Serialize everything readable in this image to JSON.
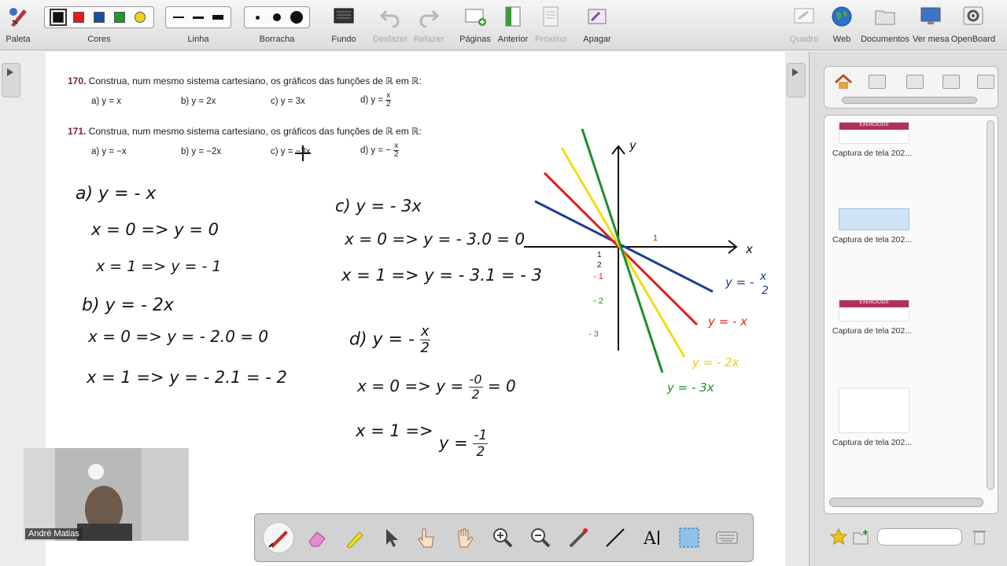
{
  "toolbar": {
    "items": [
      {
        "label": "Paleta"
      },
      {
        "label": "Cores"
      },
      {
        "label": "Linha"
      },
      {
        "label": "Borracha"
      },
      {
        "label": "Fundo"
      },
      {
        "label": "Desfazer"
      },
      {
        "label": "Refazer"
      },
      {
        "label": "Páginas"
      },
      {
        "label": "Anterior"
      },
      {
        "label": "Próximo"
      },
      {
        "label": "Apagar"
      },
      {
        "label": "Quadro"
      },
      {
        "label": "Web"
      },
      {
        "label": "Documentos"
      },
      {
        "label": "Ver mesa"
      },
      {
        "label": "OpenBoard"
      }
    ],
    "colors": [
      "#111111",
      "#e21b1b",
      "#1a4ea8",
      "#1f9a2a",
      "#f3d31a"
    ]
  },
  "exercises": {
    "ex170": {
      "num": "170.",
      "text": "Construa, num mesmo sistema cartesiano, os gráficos das funções de ℝ em ℝ:",
      "a": "a)  y = x",
      "b": "b)  y = 2x",
      "c": "c)  y = 3x",
      "d": "d)  y =",
      "d_num": "x",
      "d_den": "2"
    },
    "ex171": {
      "num": "171.",
      "text": "Construa, num mesmo sistema cartesiano, os gráficos das funções de ℝ em ℝ:",
      "a": "a)  y = −x",
      "b": "b)  y = −2x",
      "c": "c)  y = −3x",
      "d": "d)  y = −",
      "d_num": "x",
      "d_den": "2"
    }
  },
  "handwriting": {
    "a_title": "a)  y = - x",
    "a_l1": "x = 0  =>  y = 0",
    "a_l2": "x = 1  =>  y = - 1",
    "b_title": "b)  y = - 2x",
    "b_l1": "x = 0 =>  y = - 2.0 = 0",
    "b_l2": "x = 1 =>  y = - 2.1  = - 2",
    "c_title": "c)  y = - 3x",
    "c_l1": "x = 0 =>  y = - 3.0 = 0",
    "c_l2": "x = 1 =>  y = - 3.1 = - 3",
    "d_title": "d)  y = -",
    "d_num": "x",
    "d_den": "2",
    "d_l1": "x = 0  =>  y =",
    "d_l1_num": "-0",
    "d_l1_den": "2",
    "d_l1_end": "= 0",
    "d_l2": "x = 1  =>",
    "d_l2_y": "y =",
    "d_l2_num": "-1",
    "d_l2_den": "2"
  },
  "graph": {
    "axis_x": "x",
    "axis_y": "y",
    "tick_1": "1",
    "tick_half_num": "1",
    "tick_half_den": "2",
    "tick_m1": "- 1",
    "tick_m2": "- 2",
    "tick_m3": "- 3",
    "label_half": "y = -",
    "label_half_num": "x",
    "label_half_den": "2",
    "label_x": "y = - x",
    "label_2x": "y = - 2x",
    "label_3x": "y = - 3x",
    "colors": {
      "blue": "#1c3f94",
      "red": "#e02020",
      "yellow": "#f2dd10",
      "green": "#1c8f2a"
    }
  },
  "right_panel": {
    "thumbs": [
      {
        "caption": "Captura de tela 202...",
        "badge": "EXERCÍCIOS"
      },
      {
        "caption": "Captura de tela 202..."
      },
      {
        "caption": "Captura de tela 202...",
        "badge": "EXERCÍCIOS"
      },
      {
        "caption": "Captura de tela 202..."
      }
    ]
  },
  "webcam": {
    "name": "André Matias"
  }
}
